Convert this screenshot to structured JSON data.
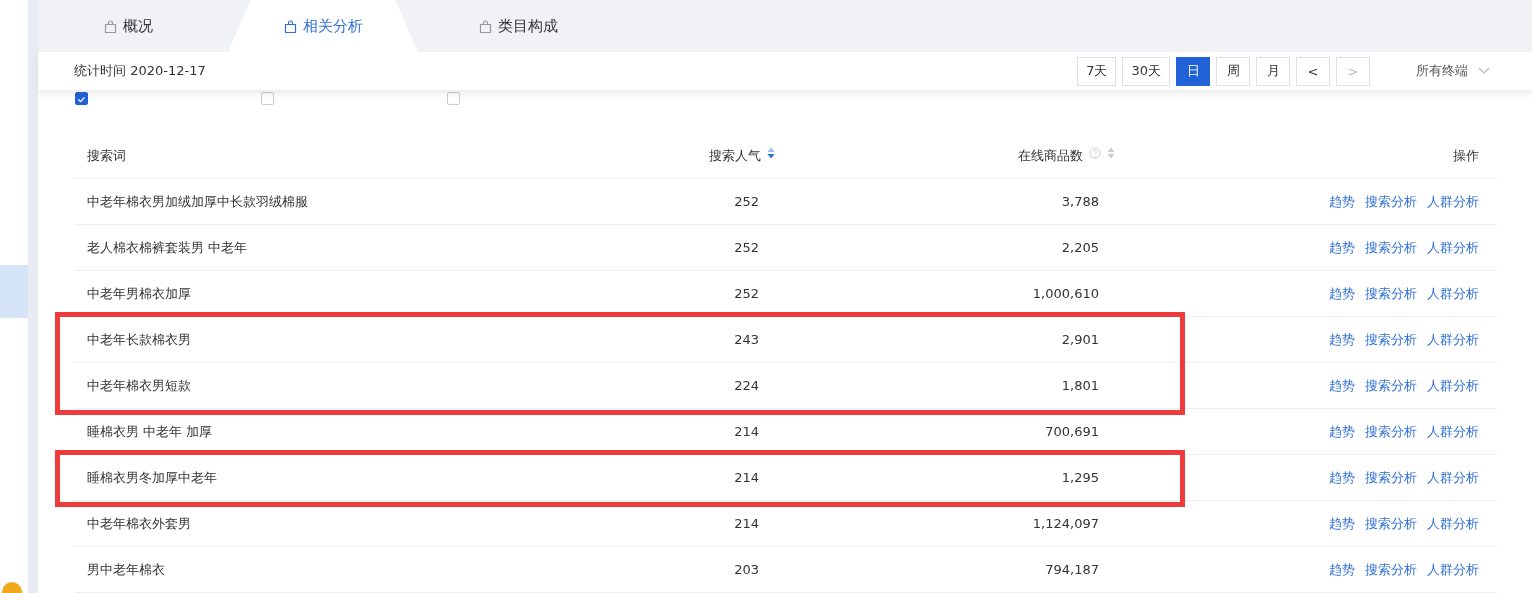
{
  "tabs": [
    {
      "label": "概况",
      "selected": false
    },
    {
      "label": "相关分析",
      "selected": true
    },
    {
      "label": "类目构成",
      "selected": false
    }
  ],
  "toolbar": {
    "stat_time": "统计时间 2020-12-17",
    "range_buttons": [
      {
        "label": "7天",
        "selected": false
      },
      {
        "label": "30天",
        "selected": false
      },
      {
        "label": "日",
        "selected": true
      },
      {
        "label": "周",
        "selected": false
      },
      {
        "label": "月",
        "selected": false
      }
    ],
    "prev": {
      "label": "<",
      "disabled": false
    },
    "next": {
      "label": ">",
      "disabled": true
    },
    "terminal": {
      "value": "所有终端"
    }
  },
  "filters": [
    {
      "checked": true
    },
    {
      "checked": false
    },
    {
      "checked": false
    }
  ],
  "table": {
    "columns": [
      {
        "label": "搜索词"
      },
      {
        "label": "搜索人气",
        "sorted": true
      },
      {
        "label": "在线商品数",
        "help": true,
        "sorted": false
      },
      {
        "label": "操作"
      }
    ],
    "rows": [
      {
        "keyword": "中老年棉衣男加绒加厚中长款羽绒棉服",
        "popularity": "252",
        "products": "3,788",
        "actions": [
          "趋势",
          "搜索分析",
          "人群分析"
        ],
        "highlighted": false
      },
      {
        "keyword": "老人棉衣棉裤套装男 中老年",
        "popularity": "252",
        "products": "2,205",
        "actions": [
          "趋势",
          "搜索分析",
          "人群分析"
        ],
        "highlighted": false
      },
      {
        "keyword": "中老年男棉衣加厚",
        "popularity": "252",
        "products": "1,000,610",
        "actions": [
          "趋势",
          "搜索分析",
          "人群分析"
        ],
        "highlighted": false
      },
      {
        "keyword": "中老年长款棉衣男",
        "popularity": "243",
        "products": "2,901",
        "actions": [
          "趋势",
          "搜索分析",
          "人群分析"
        ],
        "highlighted": true
      },
      {
        "keyword": "中老年棉衣男短款",
        "popularity": "224",
        "products": "1,801",
        "actions": [
          "趋势",
          "搜索分析",
          "人群分析"
        ],
        "highlighted": true
      },
      {
        "keyword": "睡棉衣男 中老年 加厚",
        "popularity": "214",
        "products": "700,691",
        "actions": [
          "趋势",
          "搜索分析",
          "人群分析"
        ],
        "highlighted": false
      },
      {
        "keyword": "睡棉衣男冬加厚中老年",
        "popularity": "214",
        "products": "1,295",
        "actions": [
          "趋势",
          "搜索分析",
          "人群分析"
        ],
        "highlighted": true
      },
      {
        "keyword": "中老年棉衣外套男",
        "popularity": "214",
        "products": "1,124,097",
        "actions": [
          "趋势",
          "搜索分析",
          "人群分析"
        ],
        "highlighted": false
      },
      {
        "keyword": "男中老年棉衣",
        "popularity": "203",
        "products": "794,187",
        "actions": [
          "趋势",
          "搜索分析",
          "人群分析"
        ],
        "highlighted": false
      }
    ]
  }
}
